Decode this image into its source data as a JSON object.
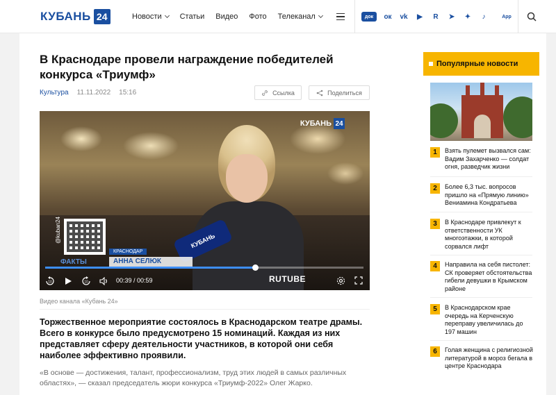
{
  "header": {
    "logo_text": "КУБАНЬ",
    "logo_num": "24",
    "nav": [
      "Новости",
      "Статьи",
      "Видео",
      "Фото",
      "Телеканал"
    ],
    "socials": [
      {
        "name": "dok-icon",
        "label": "док"
      },
      {
        "name": "odnoklassniki-icon",
        "label": "ок"
      },
      {
        "name": "vk-icon",
        "label": "vk"
      },
      {
        "name": "youtube-icon",
        "label": "▶"
      },
      {
        "name": "rutube-icon",
        "label": "R"
      },
      {
        "name": "telegram-icon",
        "label": "➤"
      },
      {
        "name": "zen-icon",
        "label": "✦"
      },
      {
        "name": "music-icon",
        "label": "♪"
      },
      {
        "name": "app-icon",
        "label": "App"
      }
    ]
  },
  "article": {
    "title": "В Краснодаре провели награждение победителей конкурса «Триумф»",
    "category": "Культура",
    "date": "11.11.2022",
    "time": "15:16",
    "link_label": "Ссылка",
    "share_label": "Поделиться",
    "caption": "Видео канала «Кубань 24»",
    "lead": "Торжественное мероприятие состоялось в Краснодарском театре драмы. Всего в конкурсе было предусмотрено 15 номинаций. Каждая из них представляет сферу деятельности участников, в которой они себя наиболее эффективно проявили.",
    "quote": "«В основе — достижения, талант, профессионализм, труд этих людей в самых различных областях», — сказал председатель жюри конкурса «Триумф-2022» Олег Жарко."
  },
  "video": {
    "channel_logo": "КУБАНЬ",
    "channel_num": "24",
    "handle": "@kuban24",
    "place": "КРАСНОДАР",
    "name": "АННА СЕЛЮК",
    "facts": "ФАКТЫ",
    "mic_label": "КУБАНЬ",
    "time": "00:39 / 00:59",
    "rewind": "10",
    "forward": "10",
    "brand": "RUTUBE",
    "progress": 0.66
  },
  "sidebar": {
    "heading": "Популярные новости",
    "items": [
      {
        "num": "1",
        "text": "Взять пулемет вызвался сам: Вадим Захарченко — солдат огня, разведчик жизни"
      },
      {
        "num": "2",
        "text": "Более 6,3 тыс. вопросов пришло на «Прямую линию» Вениамина Кондратьева"
      },
      {
        "num": "3",
        "text": "В Краснодаре привлекут к ответственности УК многоэтажки, в которой сорвался лифт"
      },
      {
        "num": "4",
        "text": "Направила на себя пистолет: СК проверяет обстоятельства гибели девушки в Крымском районе"
      },
      {
        "num": "5",
        "text": "В Краснодарском крае очередь на Керченскую переправу увеличилась до 197 машин"
      },
      {
        "num": "6",
        "text": "Голая женщина с религиозной литературой в мороз бегала в центре Краснодара"
      }
    ]
  }
}
